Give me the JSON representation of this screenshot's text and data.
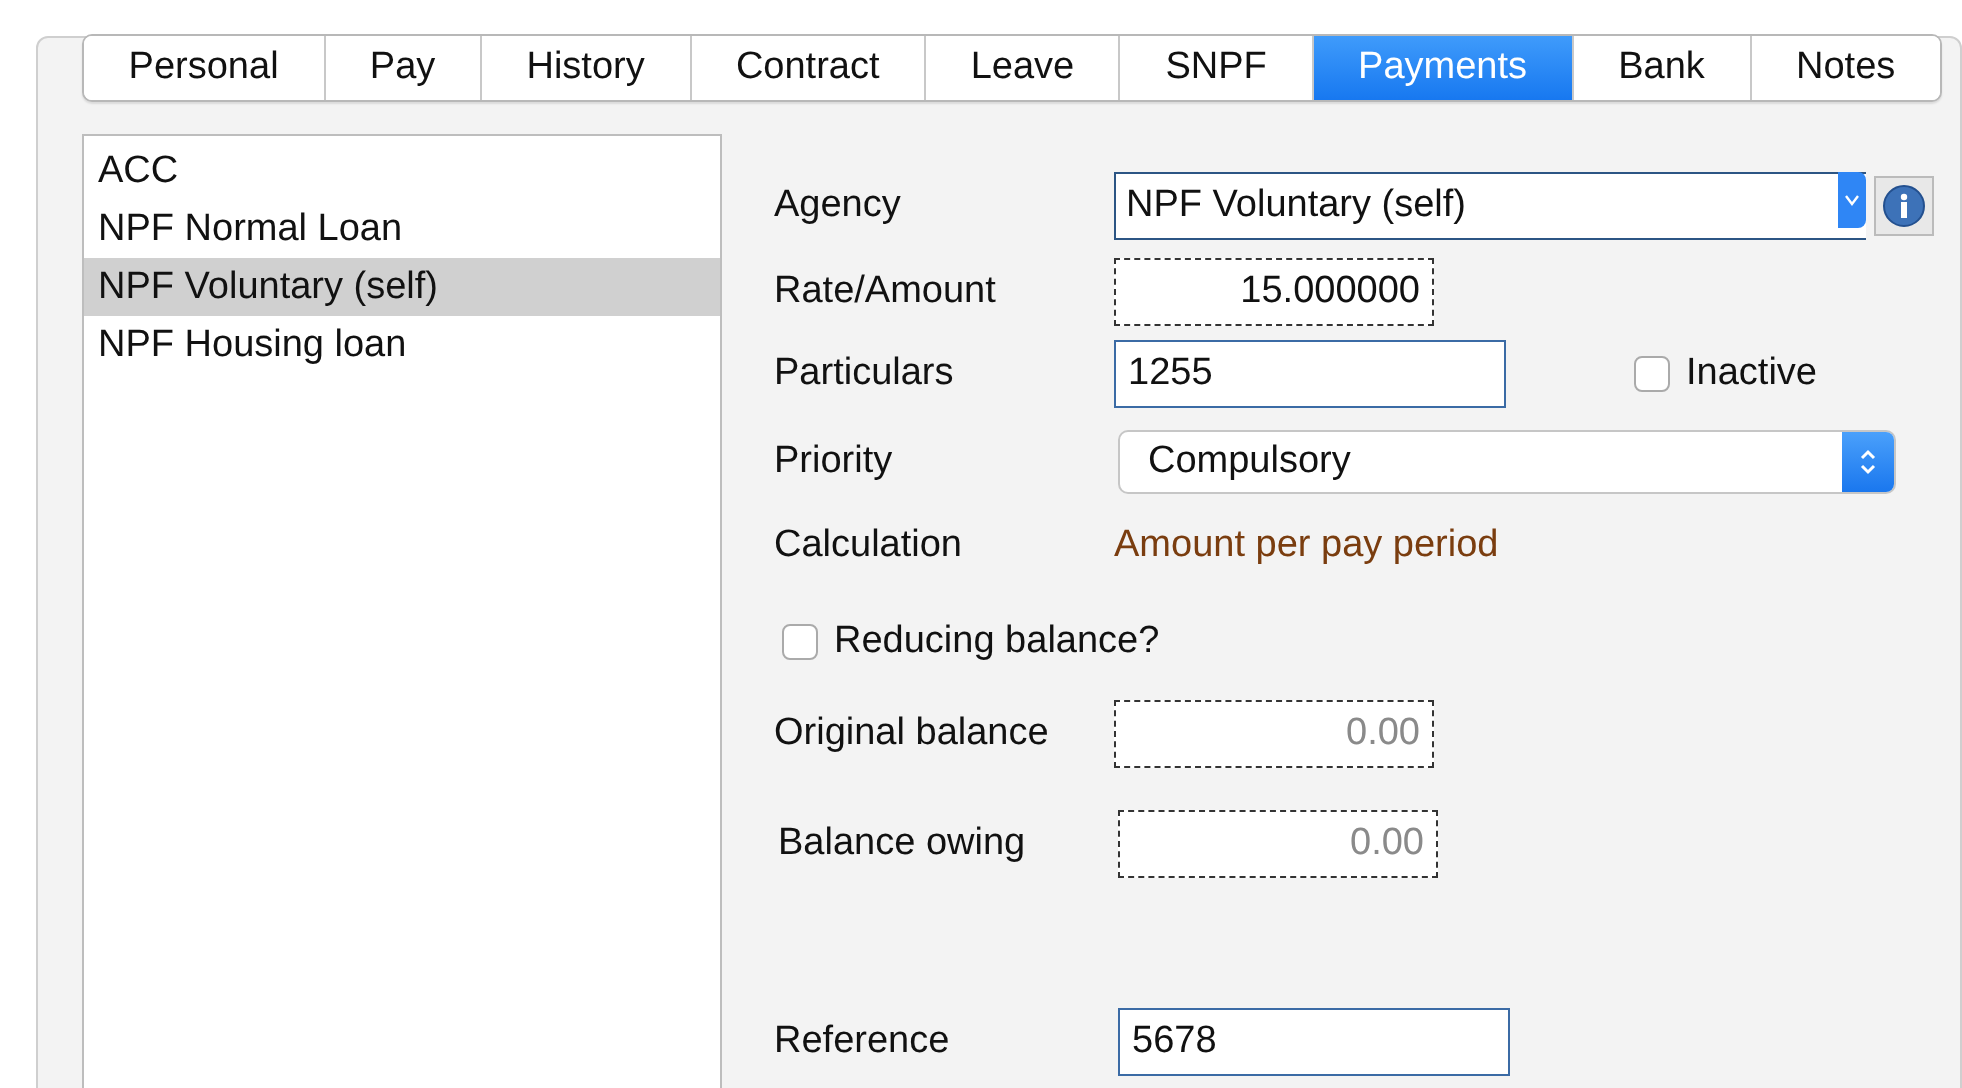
{
  "tabs": [
    {
      "label": "Personal",
      "selected": false
    },
    {
      "label": "Pay",
      "selected": false
    },
    {
      "label": "History",
      "selected": false
    },
    {
      "label": "Contract",
      "selected": false
    },
    {
      "label": "Leave",
      "selected": false
    },
    {
      "label": "SNPF",
      "selected": false
    },
    {
      "label": "Payments",
      "selected": true
    },
    {
      "label": "Bank",
      "selected": false
    },
    {
      "label": "Notes",
      "selected": false
    }
  ],
  "payments_list": [
    {
      "label": "ACC",
      "selected": false
    },
    {
      "label": "NPF Normal Loan",
      "selected": false
    },
    {
      "label": "NPF Voluntary (self)",
      "selected": true
    },
    {
      "label": "NPF Housing loan",
      "selected": false
    }
  ],
  "form": {
    "agency": {
      "label": "Agency",
      "value": "NPF Voluntary (self)"
    },
    "rate_amount": {
      "label": "Rate/Amount",
      "value": "15.000000"
    },
    "particulars": {
      "label": "Particulars",
      "value": "1255"
    },
    "inactive": {
      "label": "Inactive",
      "checked": false
    },
    "priority": {
      "label": "Priority",
      "value": "Compulsory"
    },
    "calculation": {
      "label": "Calculation",
      "value": "Amount per pay period"
    },
    "reducing_balance": {
      "label": "Reducing balance?",
      "checked": false
    },
    "original_balance": {
      "label": "Original balance",
      "value": "0.00"
    },
    "balance_owing": {
      "label": "Balance owing",
      "value": "0.00"
    },
    "reference": {
      "label": "Reference",
      "value": "5678"
    }
  }
}
